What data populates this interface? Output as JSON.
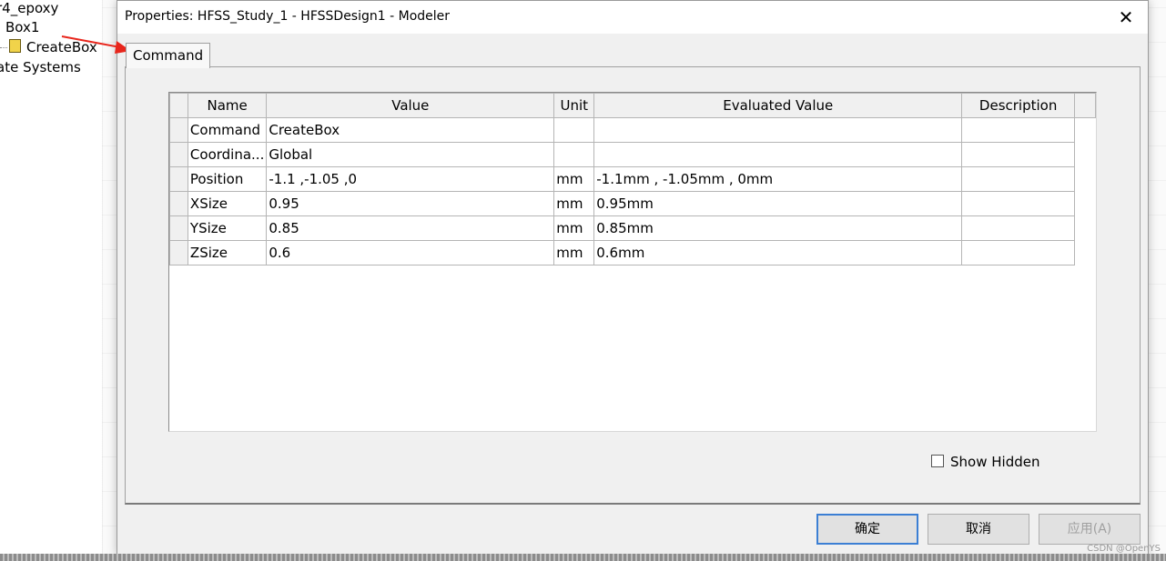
{
  "tree": {
    "items": [
      "r4_epoxy",
      "Box1",
      "CreateBox",
      "ate Systems"
    ]
  },
  "dialog": {
    "title": "Properties: HFSS_Study_1 - HFSSDesign1 - Modeler",
    "close_glyph": "✕",
    "tab_label": "Command",
    "columns": [
      "Name",
      "Value",
      "Unit",
      "Evaluated Value",
      "Description"
    ],
    "rows": [
      {
        "name": "Command",
        "value": "CreateBox",
        "unit": "",
        "evaluated": "",
        "description": ""
      },
      {
        "name": "Coordina...",
        "value": "Global",
        "unit": "",
        "evaluated": "",
        "description": ""
      },
      {
        "name": "Position",
        "value": "-1.1 ,-1.05 ,0",
        "unit": "mm",
        "evaluated": "-1.1mm , -1.05mm , 0mm",
        "description": ""
      },
      {
        "name": "XSize",
        "value": "0.95",
        "unit": "mm",
        "evaluated": "0.95mm",
        "description": ""
      },
      {
        "name": "YSize",
        "value": "0.85",
        "unit": "mm",
        "evaluated": "0.85mm",
        "description": ""
      },
      {
        "name": "ZSize",
        "value": "0.6",
        "unit": "mm",
        "evaluated": "0.6mm",
        "description": ""
      }
    ],
    "show_hidden_label": "Show Hidden",
    "show_hidden_checked": false,
    "ok_label": "确定",
    "cancel_label": "取消",
    "apply_label": "应用(A)"
  },
  "watermark": "CSDN @OpenYS",
  "colors": {
    "annotation_arrow": "#e8261c",
    "default_button_border": "#3c7fd4"
  }
}
